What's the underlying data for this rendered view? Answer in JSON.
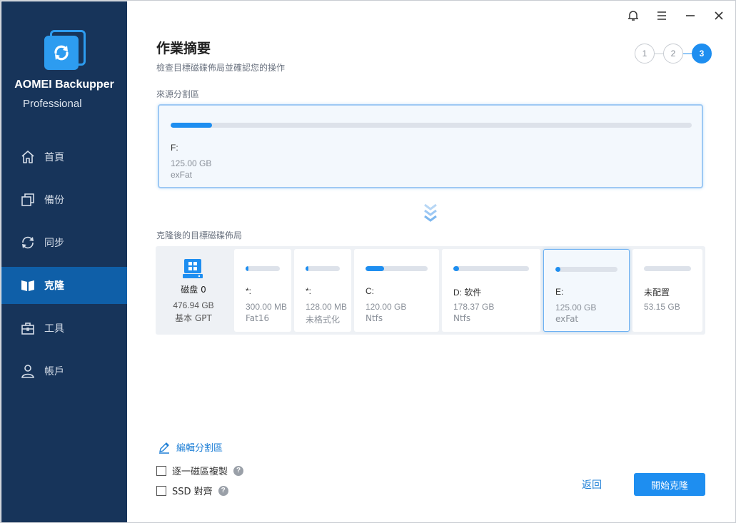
{
  "app": {
    "name": "AOMEI Backupper",
    "edition": "Professional"
  },
  "sidebar": {
    "items": [
      {
        "label": "首頁",
        "icon": "home-icon"
      },
      {
        "label": "備份",
        "icon": "backup-icon"
      },
      {
        "label": "同步",
        "icon": "sync-icon"
      },
      {
        "label": "克隆",
        "icon": "clone-icon",
        "active": true
      },
      {
        "label": "工具",
        "icon": "toolbox-icon"
      },
      {
        "label": "帳戶",
        "icon": "user-icon"
      }
    ]
  },
  "header": {
    "title": "作業摘要",
    "subtitle": "檢查目標磁碟佈局並確認您的操作"
  },
  "steps": [
    "1",
    "2",
    "3"
  ],
  "active_step": 3,
  "source": {
    "label": "來源分割區",
    "letter": "F:",
    "size": "125.00 GB",
    "fs": "exFat",
    "used_fraction": 0.08
  },
  "target": {
    "label": "克隆後的目標磁碟佈局",
    "disk": {
      "name": "磁盘 0",
      "size": "476.94 GB",
      "type": "基本 GPT"
    },
    "partitions": [
      {
        "label": "*:",
        "size": "300.00 MB",
        "fs": "Fat16",
        "used_fraction": 0.08
      },
      {
        "label": "*:",
        "size": "128.00 MB",
        "fs": "未格式化",
        "used_fraction": 0.08
      },
      {
        "label": "C:",
        "size": "120.00 GB",
        "fs": "Ntfs",
        "used_fraction": 0.3
      },
      {
        "label": "D: 软件",
        "size": "178.37 GB",
        "fs": "Ntfs",
        "used_fraction": 0.04
      },
      {
        "label": "E:",
        "size": "125.00 GB",
        "fs": "exFat",
        "used_fraction": 0.07,
        "selected": true
      },
      {
        "label": "未配置",
        "size": "53.15 GB",
        "fs": "",
        "used_fraction": 0
      }
    ]
  },
  "actions": {
    "edit_partition": "編輯分割區",
    "sector_copy": "逐一磁區複製",
    "ssd_align": "SSD 對齊",
    "back": "返回",
    "start": "開始克隆"
  },
  "colors": {
    "sidebar_bg": "#17345a",
    "sidebar_active": "#0f5fa8",
    "accent": "#1e8ef0"
  }
}
